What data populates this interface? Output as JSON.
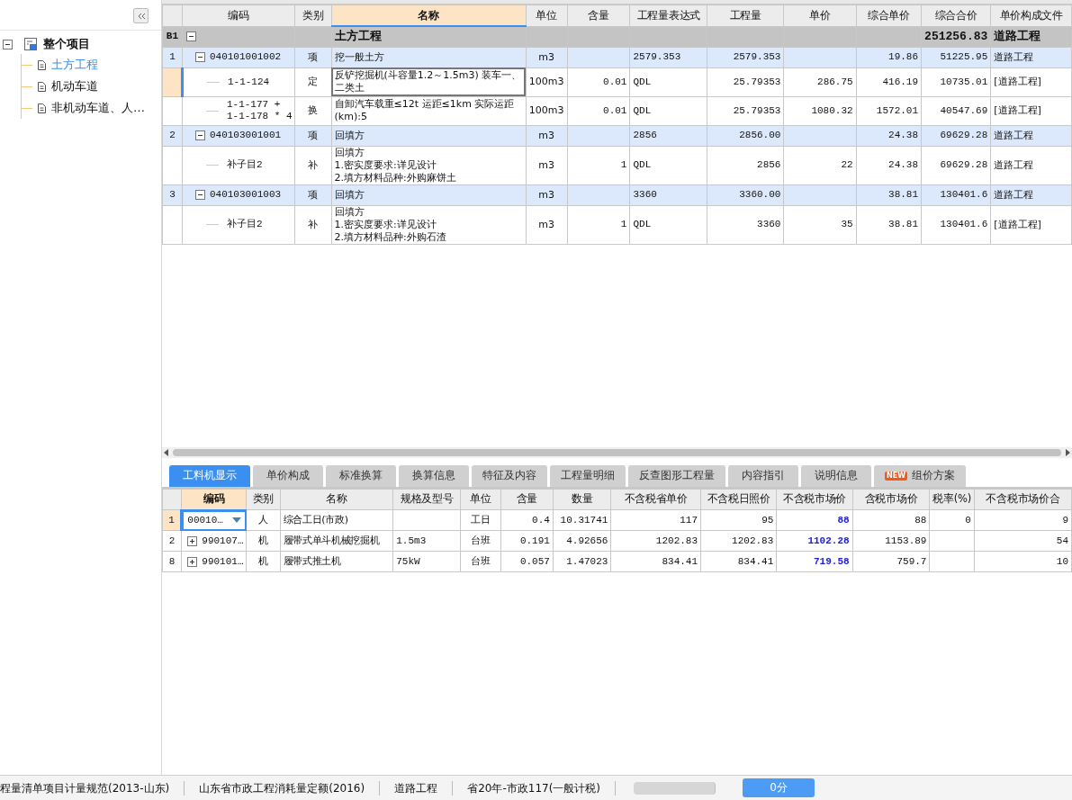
{
  "sidebar": {
    "tree": {
      "label": "整个项目",
      "expanded": true,
      "children": [
        {
          "label": "土方工程",
          "selected": true
        },
        {
          "label": "机动车道",
          "selected": false
        },
        {
          "label": "非机动车道、人…",
          "selected": false
        }
      ]
    }
  },
  "bill_table": {
    "columns": [
      {
        "label": "编码",
        "selected": false
      },
      {
        "label": "类别",
        "selected": false
      },
      {
        "label": "名称",
        "selected": true
      },
      {
        "label": "单位",
        "selected": false
      },
      {
        "label": "含量",
        "selected": false
      },
      {
        "label": "工程量表达式",
        "selected": false
      },
      {
        "label": "工程量",
        "selected": false
      },
      {
        "label": "单价",
        "selected": false
      },
      {
        "label": "综合单价",
        "selected": false
      },
      {
        "label": "综合合价",
        "selected": false
      },
      {
        "label": "单价构成文件",
        "selected": false
      }
    ],
    "rows": [
      {
        "kind": "group",
        "num": "B1",
        "expanded": true,
        "selected": false,
        "cells": [
          "",
          "",
          "土方工程",
          "",
          "",
          "",
          "",
          "",
          "",
          "251256.83",
          "道路工程"
        ]
      },
      {
        "kind": "item",
        "num": "1",
        "expanded": true,
        "selected": false,
        "cells": [
          "040101001002",
          "项",
          "挖一般土方",
          "m3",
          "",
          "2579.353",
          "2579.353",
          "",
          "19.86",
          "51225.95",
          "道路工程"
        ]
      },
      {
        "kind": "sub",
        "num": "",
        "selected": true,
        "cells": [
          "1-1-124",
          "定",
          "反铲挖掘机(斗容量1.2～1.5m3) 装车一、二类土",
          "100m3",
          "0.01",
          "QDL",
          "25.79353",
          "286.75",
          "416.19",
          "10735.01",
          "[道路工程]"
        ]
      },
      {
        "kind": "sub",
        "num": "",
        "selected": false,
        "cells": [
          "1-1-177 +\n1-1-178 * 4",
          "换",
          "自卸汽车载重≤12t 运距≤1km  实际运距(km):5",
          "100m3",
          "0.01",
          "QDL",
          "25.79353",
          "1080.32",
          "1572.01",
          "40547.69",
          "[道路工程]"
        ]
      },
      {
        "kind": "item",
        "num": "2",
        "expanded": true,
        "selected": false,
        "cells": [
          "040103001001",
          "项",
          "回填方",
          "m3",
          "",
          "2856",
          "2856.00",
          "",
          "24.38",
          "69629.28",
          "道路工程"
        ]
      },
      {
        "kind": "sub",
        "num": "",
        "selected": false,
        "cells": [
          "补子目2",
          "补",
          "回填方\n1.密实度要求:详见设计\n2.填方材料品种:外购麻饼土",
          "m3",
          "1",
          "QDL",
          "2856",
          "22",
          "24.38",
          "69629.28",
          "道路工程"
        ]
      },
      {
        "kind": "item",
        "num": "3",
        "expanded": true,
        "selected": false,
        "cells": [
          "040103001003",
          "项",
          "回填方",
          "m3",
          "",
          "3360",
          "3360.00",
          "",
          "38.81",
          "130401.6",
          "道路工程"
        ]
      },
      {
        "kind": "sub",
        "num": "",
        "selected": false,
        "cells": [
          "补子目2",
          "补",
          "回填方\n1.密实度要求:详见设计\n2.填方材料品种:外购石渣",
          "m3",
          "1",
          "QDL",
          "3360",
          "35",
          "38.81",
          "130401.6",
          "[道路工程]"
        ]
      }
    ]
  },
  "detail_tabs": [
    {
      "label": "工料机显示",
      "selected": true
    },
    {
      "label": "单价构成",
      "selected": false
    },
    {
      "label": "标准换算",
      "selected": false
    },
    {
      "label": "换算信息",
      "selected": false
    },
    {
      "label": "特征及内容",
      "selected": false
    },
    {
      "label": "工程量明细",
      "selected": false
    },
    {
      "label": "反查图形工程量",
      "selected": false
    },
    {
      "label": "内容指引",
      "selected": false
    },
    {
      "label": "说明信息",
      "selected": false
    },
    {
      "label": "组价方案",
      "selected": false,
      "badge": "NEW"
    }
  ],
  "resource_table": {
    "columns": [
      {
        "label": "编码",
        "selected": true,
        "emphasized": false
      },
      {
        "label": "类别",
        "selected": false,
        "emphasized": false
      },
      {
        "label": "名称",
        "selected": false,
        "emphasized": false
      },
      {
        "label": "规格及型号",
        "selected": false,
        "emphasized": false
      },
      {
        "label": "单位",
        "selected": false,
        "emphasized": false
      },
      {
        "label": "含量",
        "selected": false,
        "emphasized": false
      },
      {
        "label": "数量",
        "selected": false,
        "emphasized": false
      },
      {
        "label": "不含税省单价",
        "selected": false,
        "emphasized": false
      },
      {
        "label": "不含税日照价",
        "selected": false,
        "emphasized": false
      },
      {
        "label": "不含税市场价",
        "selected": false,
        "emphasized": true
      },
      {
        "label": "含税市场价",
        "selected": false,
        "emphasized": false
      },
      {
        "label": "税率(%)",
        "selected": false,
        "emphasized": false
      },
      {
        "label": "不含税市场价合",
        "selected": false,
        "emphasized": false
      }
    ],
    "rows": [
      {
        "num": "1",
        "selected": true,
        "cells": [
          "00010…",
          "人",
          "综合工日(市政)",
          "",
          "工日",
          "0.4",
          "10.31741",
          "117",
          "95",
          "88",
          "88",
          "0",
          "9"
        ]
      },
      {
        "num": "2",
        "selected": false,
        "expanded": false,
        "cells": [
          "990107…",
          "机",
          "履带式单斗机械挖掘机",
          "1.5m3",
          "台班",
          "0.191",
          "4.92656",
          "1202.83",
          "1202.83",
          "1102.28",
          "1153.89",
          "",
          "54"
        ]
      },
      {
        "num": "8",
        "selected": false,
        "expanded": false,
        "cells": [
          "990101…",
          "机",
          "履带式推土机",
          "75kW",
          "台班",
          "0.057",
          "1.47023",
          "834.41",
          "834.41",
          "719.58",
          "759.7",
          "",
          "10"
        ]
      }
    ]
  },
  "status_bar": {
    "items": [
      "程量清单项目计量规范(2013-山东)",
      "山东省市政工程消耗量定额(2016)",
      "道路工程",
      "省20年-市政117(一般计税)"
    ],
    "score_button": "0分"
  }
}
